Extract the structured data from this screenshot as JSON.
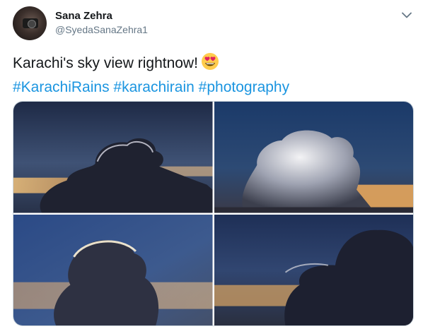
{
  "author": {
    "name": "Sana Zehra",
    "handle": "@SyedaSanaZehra1"
  },
  "tweet": {
    "text": "Karachi's sky view rightnow!",
    "emoji": "heart-eyes-emoji",
    "hashtags": [
      "#KarachiRains",
      "#karachirain",
      "#photography"
    ]
  },
  "media": {
    "photos": [
      "cloud-photo-1",
      "cloud-photo-2",
      "cloud-photo-3",
      "cloud-photo-4"
    ]
  },
  "icons": {
    "more": "chevron-down-icon"
  },
  "colors": {
    "link": "#1b95e0",
    "text": "#14171a",
    "secondary": "#657786"
  }
}
